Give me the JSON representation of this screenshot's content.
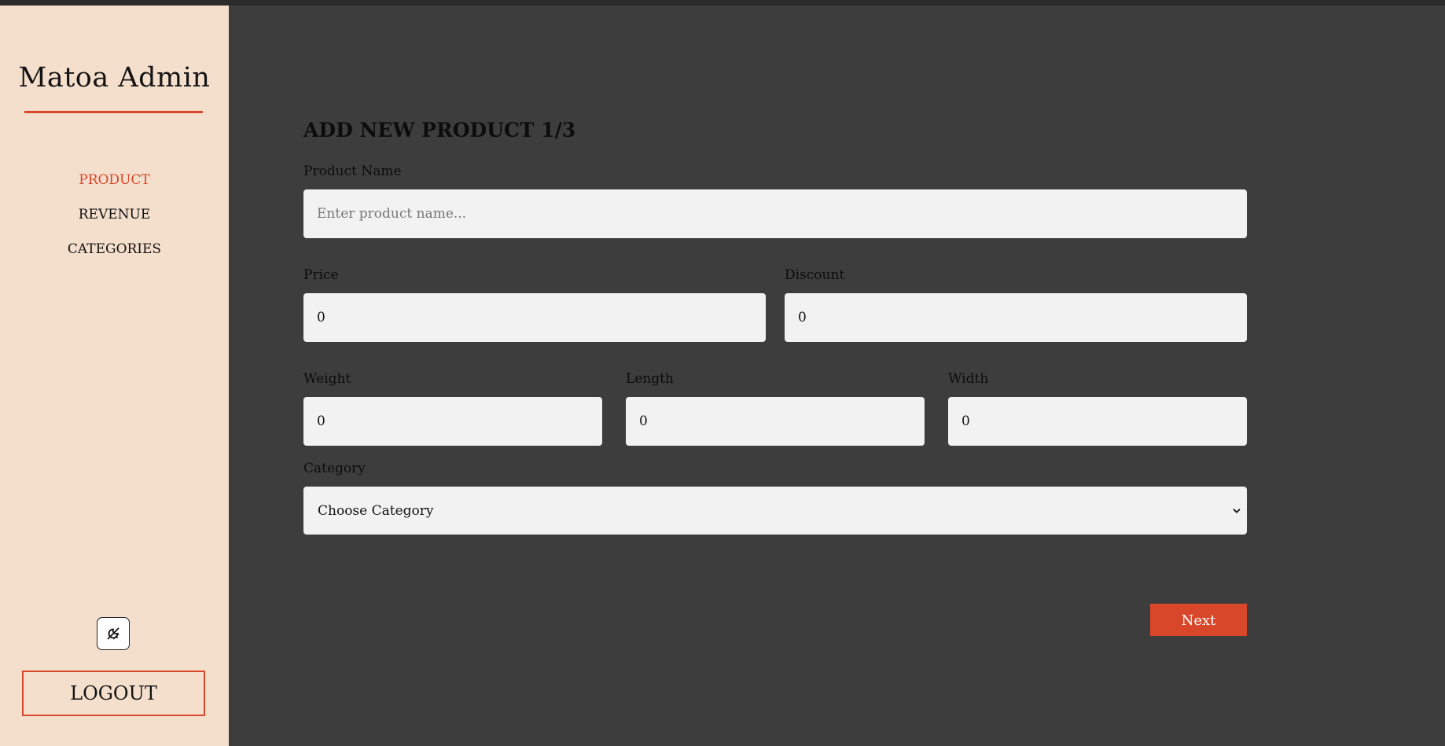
{
  "app": {
    "brand": "Matoa Admin",
    "accent_color": "#d9472a",
    "sidebar_bg": "#f4dfcd",
    "main_bg": "#3d3d3d"
  },
  "sidebar": {
    "items": [
      {
        "label": "PRODUCT",
        "active": true
      },
      {
        "label": "REVENUE",
        "active": false
      },
      {
        "label": "CATEGORIES",
        "active": false
      }
    ],
    "theme_toggle_icon": "theme-toggle-icon",
    "logout_label": "LOGOUT"
  },
  "form": {
    "title": "ADD NEW PRODUCT 1/3",
    "product_name": {
      "label": "Product Name",
      "placeholder": "Enter product name...",
      "value": ""
    },
    "price": {
      "label": "Price",
      "value": "0"
    },
    "discount": {
      "label": "Discount",
      "value": "0"
    },
    "weight": {
      "label": "Weight",
      "value": "0"
    },
    "length": {
      "label": "Length",
      "value": "0"
    },
    "width": {
      "label": "Width",
      "value": "0"
    },
    "category": {
      "label": "Category",
      "selected": "Choose Category"
    },
    "next_label": "Next"
  }
}
